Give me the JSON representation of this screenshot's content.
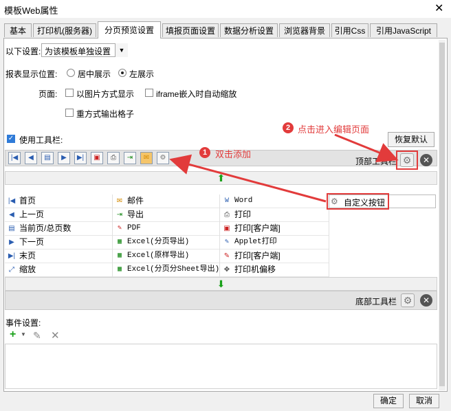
{
  "window": {
    "title": "模板Web属性",
    "close_glyph": "✕"
  },
  "tabs": [
    "基本",
    "打印机(服务器)",
    "分页预览设置",
    "填报页面设置",
    "数据分析设置",
    "浏览器背景",
    "引用Css",
    "引用JavaScript"
  ],
  "settings": {
    "scope_label": "以下设置:",
    "scope_value": "为该模板单独设置",
    "position_label": "报表显示位置:",
    "position_center": "居中展示",
    "position_left": "左展示",
    "page_label": "页面:",
    "opt_image_display": "以图片方式显示",
    "opt_iframe_autoscale": "iframe嵌入时自动缩放",
    "opt_reprint_cells": "重方式输出格子",
    "use_toolbar": "使用工具栏:",
    "restore_default": "恢复默认"
  },
  "toolbar": {
    "top_label": "顶部工具栏",
    "bottom_label": "底部工具栏"
  },
  "buttons": {
    "col1": [
      {
        "icon": "first-page-icon",
        "label": "首页"
      },
      {
        "icon": "prev-page-icon",
        "label": "上一页"
      },
      {
        "icon": "page-count-icon",
        "label": "当前页/总页数"
      },
      {
        "icon": "next-page-icon",
        "label": "下一页"
      },
      {
        "icon": "last-page-icon",
        "label": "末页"
      },
      {
        "icon": "zoom-icon",
        "label": "缩放"
      }
    ],
    "col2": [
      {
        "icon": "mail-icon",
        "label": "邮件"
      },
      {
        "icon": "export-icon",
        "label": "导出"
      },
      {
        "icon": "pdf-icon",
        "label": "PDF"
      },
      {
        "icon": "excel-icon",
        "label": "Excel(分页导出)"
      },
      {
        "icon": "excel-icon",
        "label": "Excel(原样导出)"
      },
      {
        "icon": "excel-icon",
        "label": "Excel(分页分Sheet导出)"
      }
    ],
    "col3": [
      {
        "icon": "word-icon",
        "label": "Word"
      },
      {
        "icon": "print-icon",
        "label": "打印"
      },
      {
        "icon": "print-client-icon",
        "label": "打印[客户端]"
      },
      {
        "icon": "applet-print-icon",
        "label": "Applet打印"
      },
      {
        "icon": "print-client-pdf-icon",
        "label": "打印[客户端]"
      },
      {
        "icon": "printer-offset-icon",
        "label": "打印机偏移"
      }
    ],
    "custom": {
      "icon": "gear-icon",
      "label": "自定义按钮"
    }
  },
  "annotations": {
    "step1_num": "1",
    "step1_text": "双击添加",
    "step2_num": "2",
    "step2_text": "点击进入编辑页面"
  },
  "events": {
    "label": "事件设置:"
  },
  "footer": {
    "ok": "确定",
    "cancel": "取消"
  },
  "colors": {
    "annotation_red": "#e23b3b",
    "accent_blue": "#2f7bd8",
    "drop_green": "#1aa11a"
  }
}
